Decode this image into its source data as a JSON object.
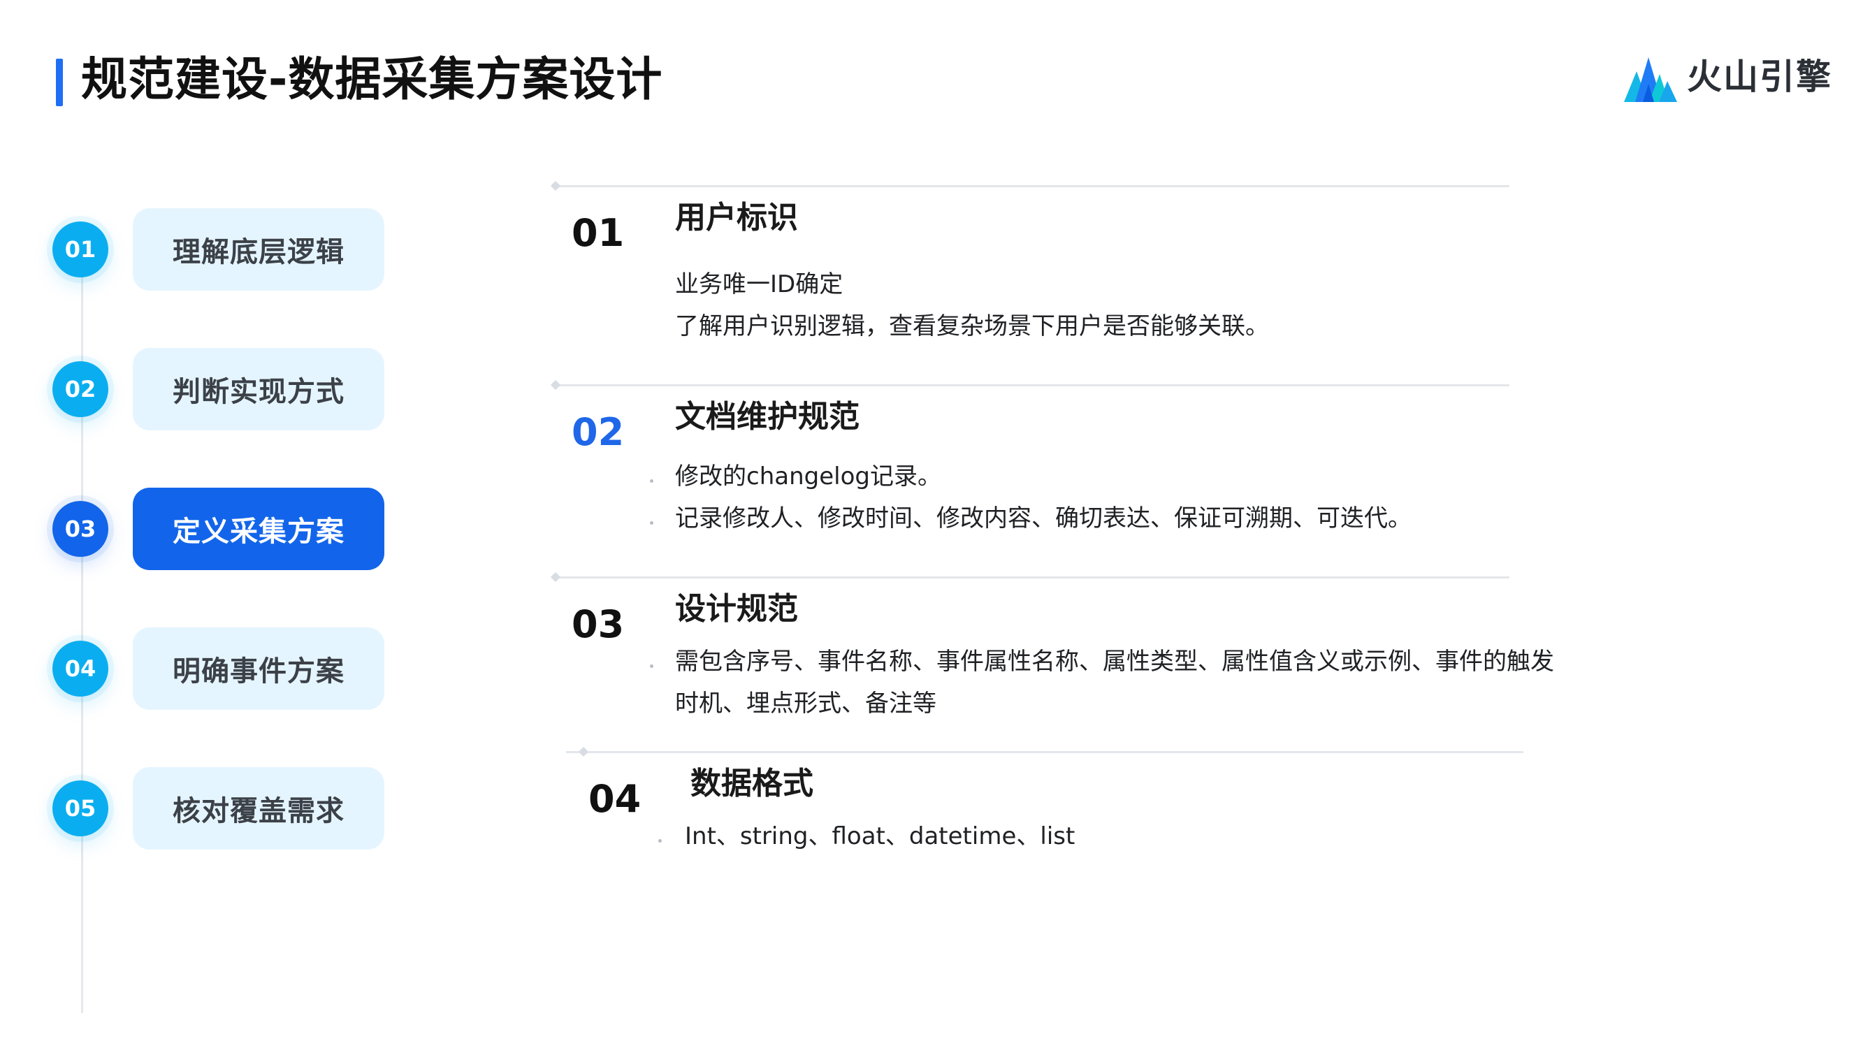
{
  "page": {
    "title": "规范建设-数据采集方案设计"
  },
  "brand": {
    "name": "火山引擎",
    "logo_icon": "volcano-engine-logo"
  },
  "colors": {
    "accent_blue": "#1265ea",
    "circle_cyan": "#0aaef0",
    "pill_light": "#e5f5ff",
    "title_bar": "#1f6ef5"
  },
  "left_nav": {
    "items": [
      {
        "number": "01",
        "label": "理解底层逻辑",
        "active": false
      },
      {
        "number": "02",
        "label": "判断实现方式",
        "active": false
      },
      {
        "number": "03",
        "label": "定义采集方案",
        "active": true
      },
      {
        "number": "04",
        "label": "明确事件方案",
        "active": false
      },
      {
        "number": "05",
        "label": "核对覆盖需求",
        "active": false
      }
    ]
  },
  "sections": [
    {
      "number": "01",
      "heading": "用户标识",
      "lines": [
        "业务唯一ID确定",
        "了解用户识别逻辑，查看复杂场景下用户是否能够关联。"
      ]
    },
    {
      "number": "02",
      "heading": "文档维护规范",
      "lines": [
        "修改的changelog记录。",
        "记录修改人、修改时间、修改内容、确切表达、保证可溯期、可迭代。"
      ]
    },
    {
      "number": "03",
      "heading": "设计规范",
      "lines": [
        "需包含序号、事件名称、事件属性名称、属性类型、属性值含义或示例、事件的触发",
        "时机、埋点形式、备注等"
      ]
    },
    {
      "number": "04",
      "heading": "数据格式",
      "lines": [
        "Int、string、float、datetime、list"
      ]
    }
  ]
}
